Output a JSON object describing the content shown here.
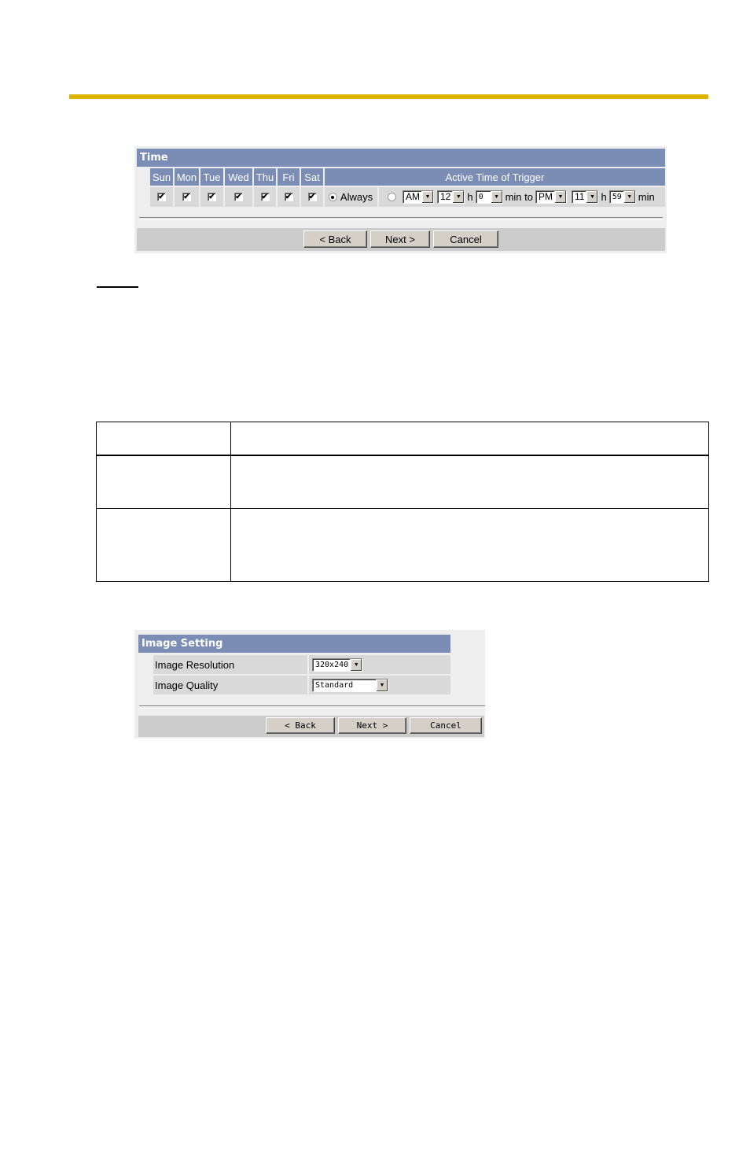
{
  "colors": {
    "gold_rule": "#dbb300",
    "panel_header": "#7b8db5",
    "panel_bg": "#eeeeee",
    "cell_bg": "#d9d9d9",
    "button_bar": "#cccccc"
  },
  "time_panel": {
    "title": "Time",
    "days": [
      {
        "label": "Sun",
        "checked": true,
        "mark": "✔"
      },
      {
        "label": "Mon",
        "checked": true,
        "mark": "✔"
      },
      {
        "label": "Tue",
        "checked": true,
        "mark": "✔"
      },
      {
        "label": "Wed",
        "checked": true,
        "mark": "✔"
      },
      {
        "label": "Thu",
        "checked": true,
        "mark": "✔"
      },
      {
        "label": "Fri",
        "checked": true,
        "mark": "✔"
      },
      {
        "label": "Sat",
        "checked": true,
        "mark": "✔"
      }
    ],
    "active_time_header": "Active Time of Trigger",
    "always_label": "Always",
    "always_selected": true,
    "range_selected": false,
    "start_ampm": "AM",
    "start_hour": "12",
    "hour_unit": "h",
    "start_min": "0",
    "min_to_label": "min to",
    "end_ampm": "PM",
    "end_hour": "11",
    "end_min": "59",
    "min_unit": "min",
    "dropdown_arrow": "▼",
    "buttons": {
      "back": "< Back",
      "next": "Next >",
      "cancel": "Cancel"
    }
  },
  "image_panel": {
    "title": "Image Setting",
    "resolution_label": "Image Resolution",
    "resolution_value": "320x240",
    "quality_label": "Image Quality",
    "quality_value": "Standard",
    "buttons": {
      "back": "< Back",
      "next": "Next >",
      "cancel": "Cancel"
    }
  }
}
